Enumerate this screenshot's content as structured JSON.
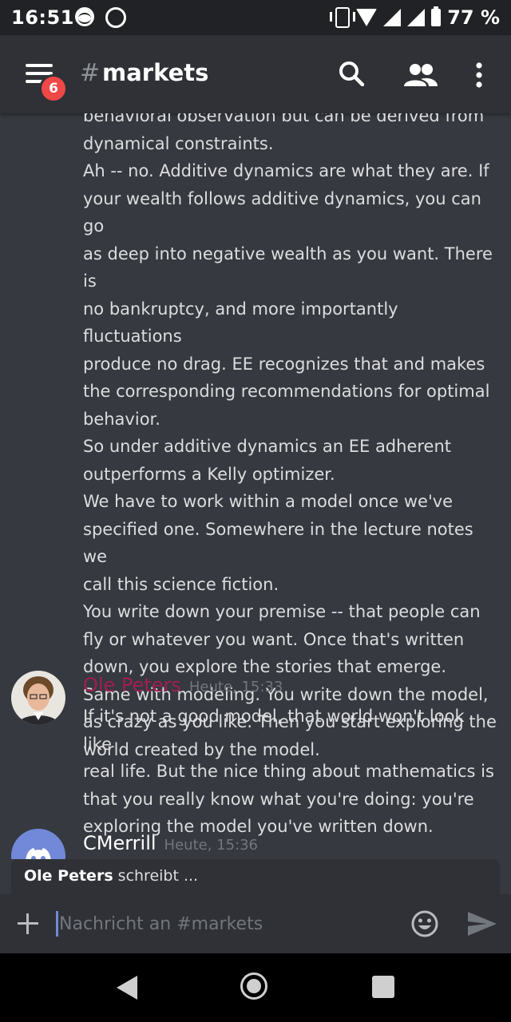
{
  "status_bar": {
    "time": "16:51",
    "battery_percent": "77 %"
  },
  "header": {
    "hash": "#",
    "channel": "markets",
    "unread_badge": "6"
  },
  "messages": {
    "continued_lines": [
      "behavioral observation but can be derived from",
      "dynamical constraints.",
      "Ah -- no. Additive dynamics are what they are. If",
      "your wealth follows additive dynamics, you can go",
      "as deep into negative wealth as you want. There is",
      "no bankruptcy, and more importantly fluctuations",
      "produce no drag. EE recognizes that and makes",
      "the corresponding recommendations for optimal",
      "behavior.",
      "So under additive dynamics an EE adherent",
      "outperforms a Kelly optimizer.",
      "We have to work within a model once we've",
      "specified one. Somewhere in the lecture notes we",
      "call this science fiction.",
      "You write down your premise -- that people can",
      "fly or whatever you want. Once that's written",
      "down, you explore the stories that emerge.",
      "Same with modeling. You write down the model,",
      "as crazy as you like. Then you start exploring the",
      "world created by the model."
    ],
    "groups": [
      {
        "author": "Ole Peters",
        "author_color": "#a01e52",
        "timestamp": "Heute, 15:33",
        "lines": [
          "If it's not a good model, that world won't look like",
          "real life. But the nice thing about mathematics is",
          "that you really know what you're doing: you're",
          "exploring the model you've written down."
        ]
      },
      {
        "author": "CMerrill",
        "author_color": "#ffffff",
        "timestamp": "Heute, 15:36",
        "lines": []
      }
    ]
  },
  "typing_indicator": {
    "name": "Ole Peters",
    "suffix": " schreibt ..."
  },
  "composer": {
    "placeholder": "Nachricht an #markets"
  },
  "colors": {
    "background": "#36393f",
    "header": "#2f3136",
    "accent": "#7289da",
    "badge": "#f04747"
  }
}
